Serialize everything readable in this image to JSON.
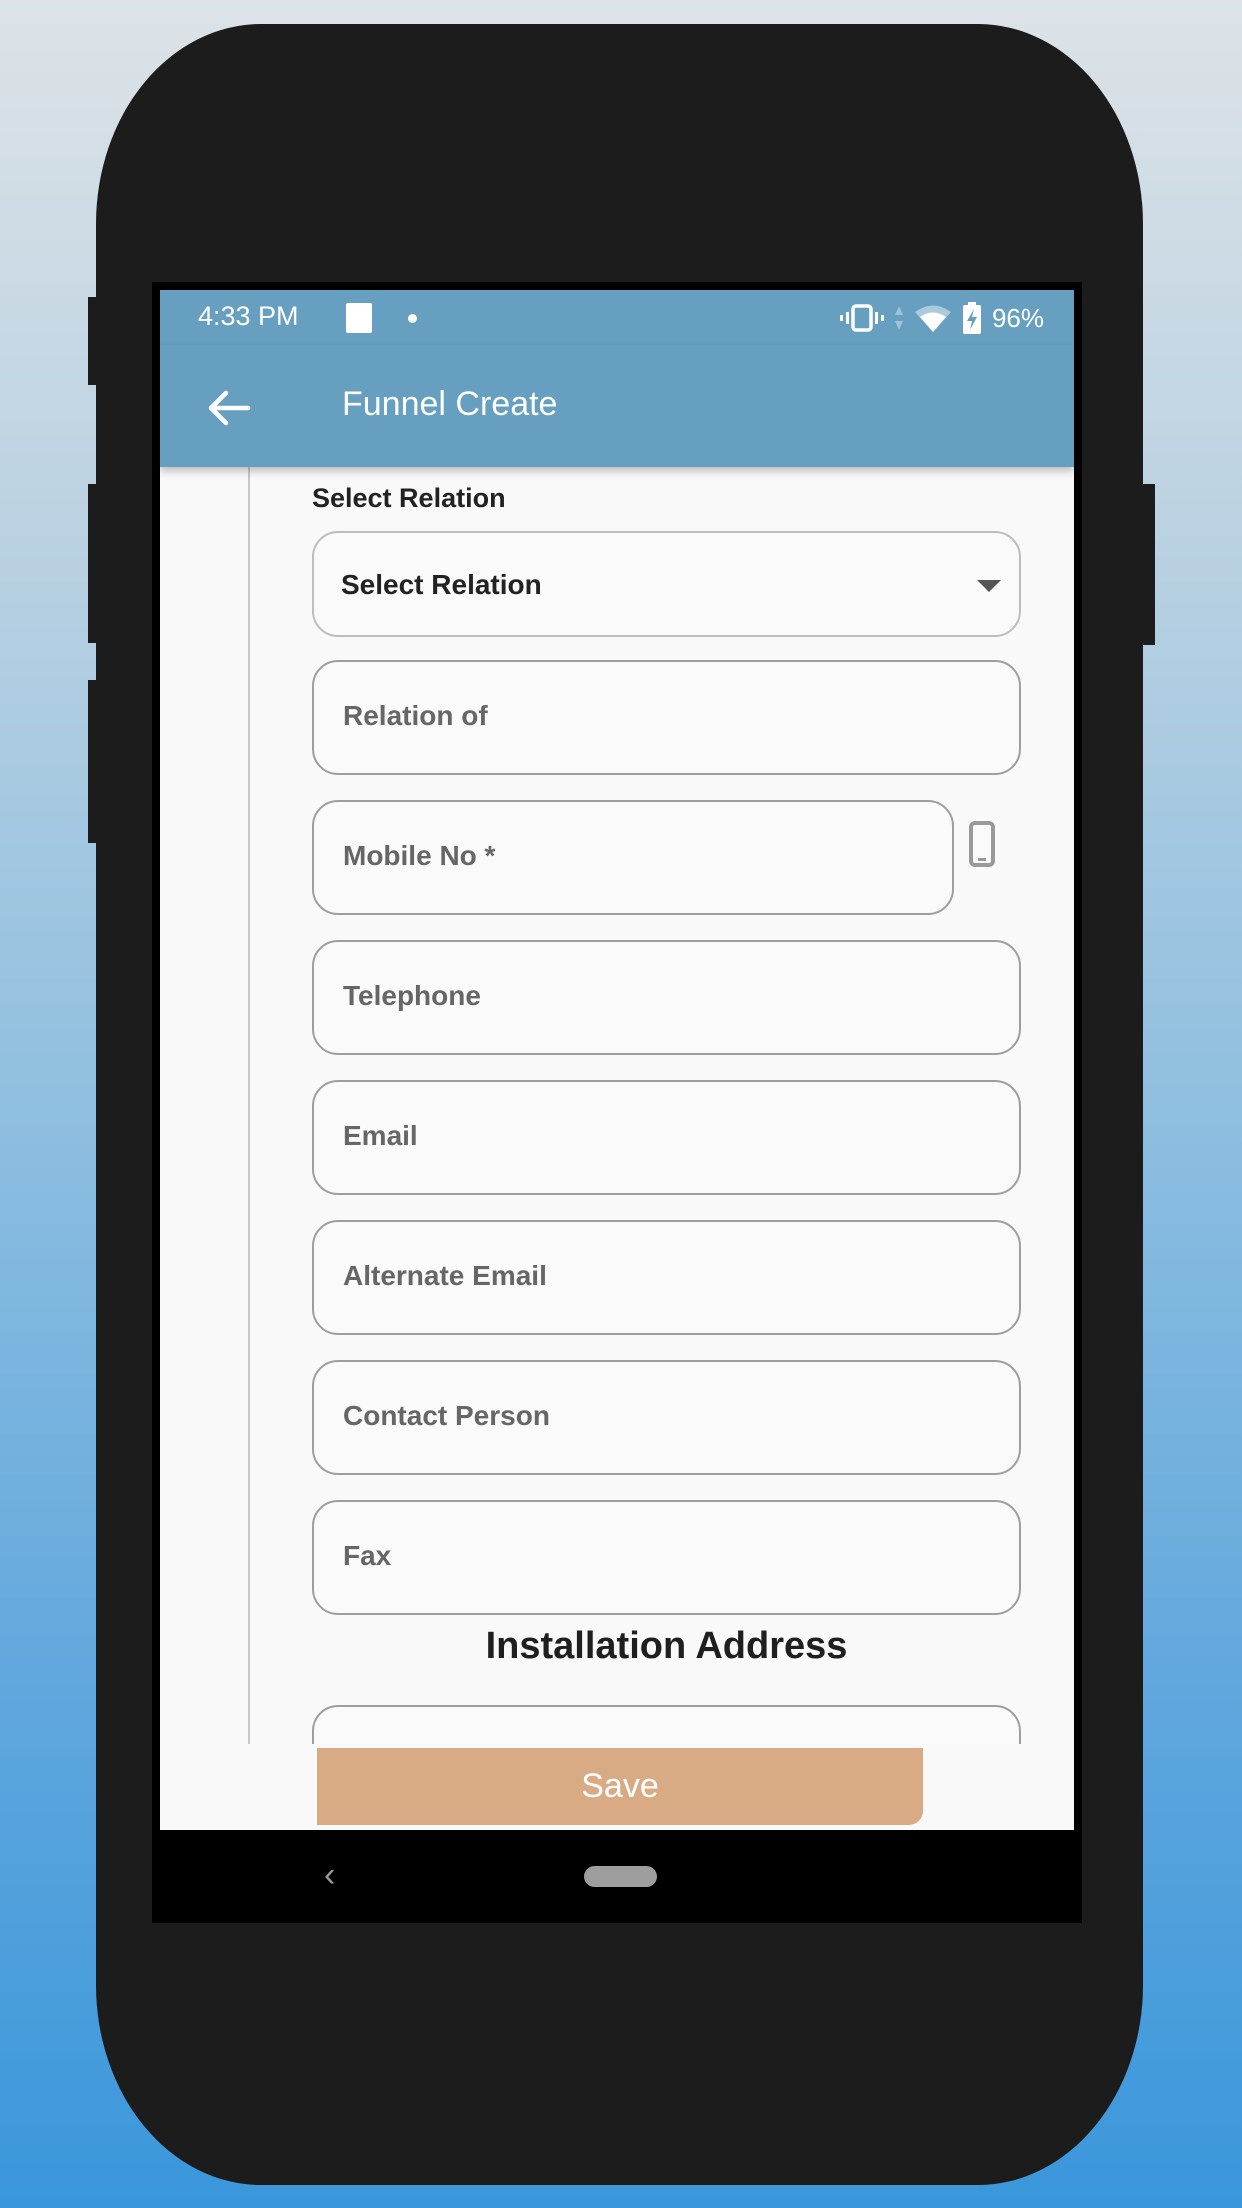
{
  "status_bar": {
    "time": "4:33 PM",
    "battery": "96%",
    "icons": [
      "sim-card-icon",
      "notification-dot-icon",
      "vibrate-icon",
      "data-arrows-icon",
      "wifi-icon",
      "battery-charging-icon"
    ]
  },
  "app_bar": {
    "title": "Funnel Create",
    "back_icon": "arrow-left-icon"
  },
  "form": {
    "relation_label": "Select Relation",
    "relation_dropdown": {
      "selected": "Select Relation"
    },
    "fields": [
      {
        "name": "relation-of",
        "placeholder": "Relation of",
        "value": ""
      },
      {
        "name": "mobile-no",
        "placeholder": "Mobile No *",
        "value": ""
      },
      {
        "name": "telephone",
        "placeholder": "Telephone",
        "value": ""
      },
      {
        "name": "email",
        "placeholder": "Email",
        "value": ""
      },
      {
        "name": "alternate-email",
        "placeholder": "Alternate Email",
        "value": ""
      },
      {
        "name": "contact-person",
        "placeholder": "Contact Person",
        "value": ""
      },
      {
        "name": "fax",
        "placeholder": "Fax",
        "value": ""
      }
    ],
    "mobile_icon": "mobile-phone-icon",
    "installation_address_title": "Installation Address",
    "save_label": "Save"
  },
  "nav_bar": {
    "back": "‹"
  },
  "colors": {
    "app_bar": "#669fbf",
    "save_button": "#d9ab85",
    "field_border": "#9e9e9e",
    "placeholder_text": "#666666"
  }
}
